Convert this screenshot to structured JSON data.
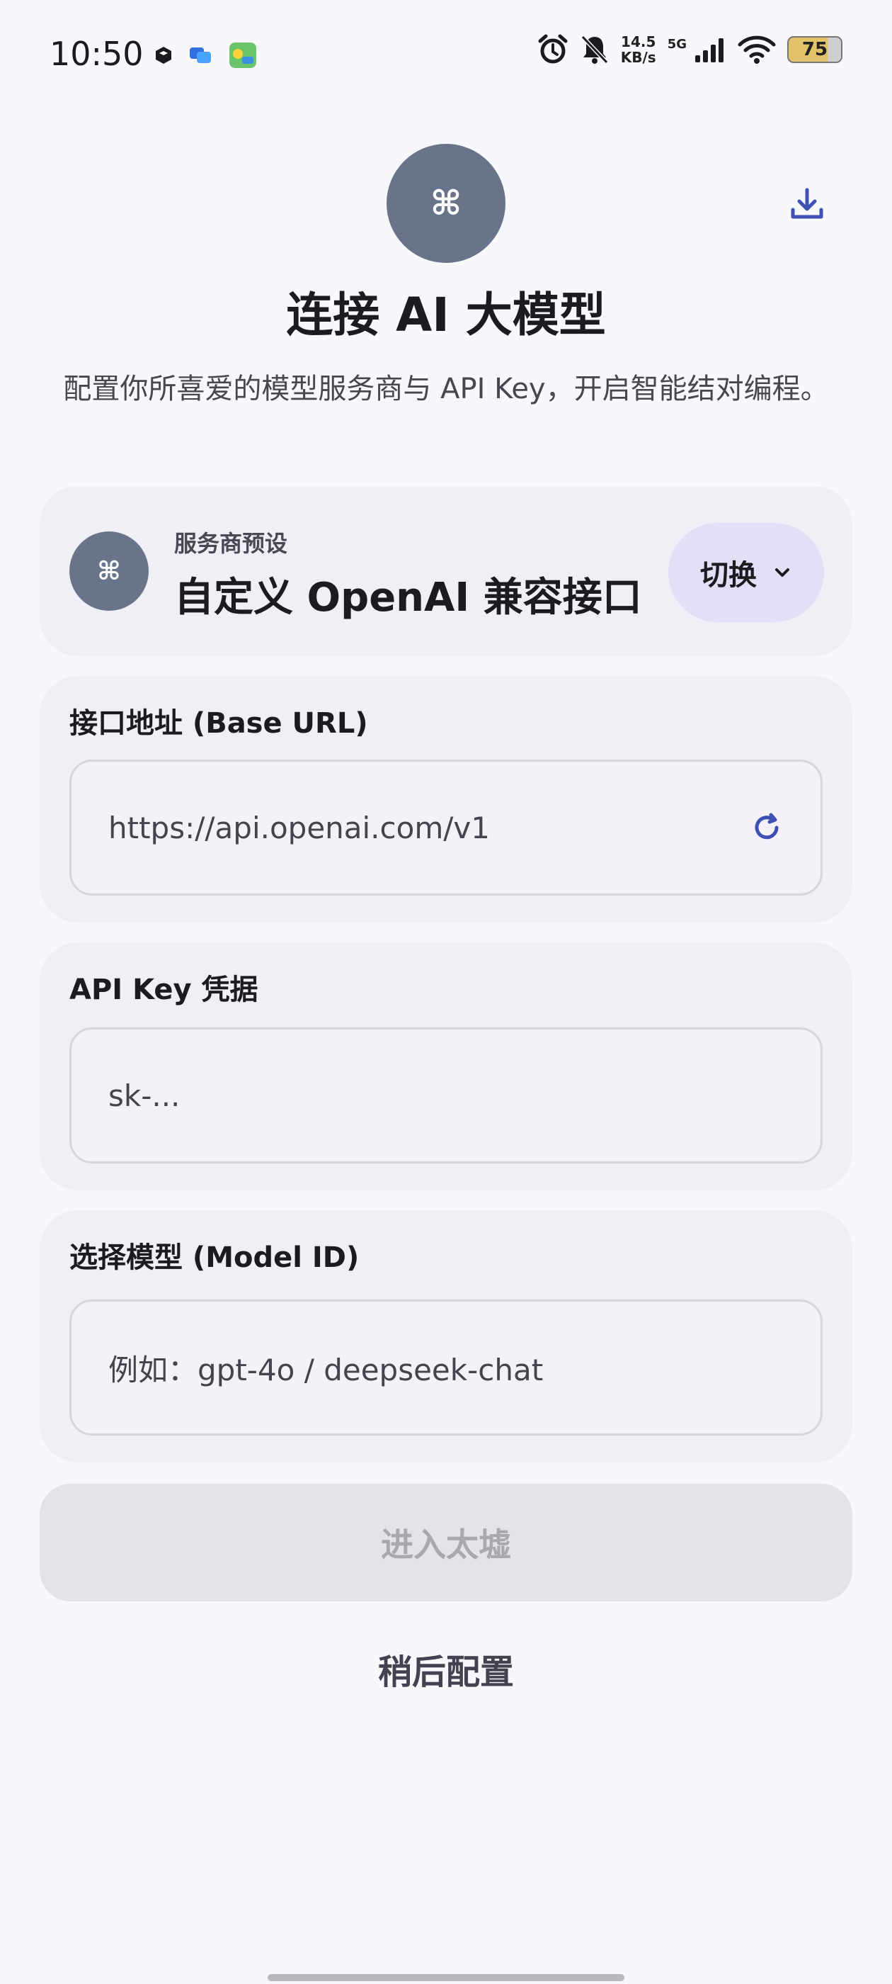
{
  "status_bar": {
    "time": "10:50",
    "net_speed_value": "14.5",
    "net_speed_unit": "KB/s",
    "network": "5G",
    "battery": "75"
  },
  "header": {
    "logo_glyph": "⌘",
    "title": "连接 AI 大模型",
    "subtitle": "配置你所喜爱的模型服务商与 API Key，开启智能结对编程。"
  },
  "provider": {
    "logo_glyph": "⌘",
    "label": "服务商预设",
    "name": "自定义 OpenAI 兼容接口",
    "switch_label": "切换"
  },
  "base_url": {
    "label": "接口地址 (Base URL)",
    "value": "https://api.openai.com/v1"
  },
  "api_key": {
    "label": "API Key 凭据",
    "placeholder": "sk-..."
  },
  "model": {
    "label": "选择模型 (Model ID)",
    "placeholder": "例如：gpt-4o / deepseek-chat"
  },
  "actions": {
    "enter_label": "进入太墟",
    "later_label": "稍后配置"
  },
  "colors": {
    "accent": "#3f51b5",
    "logo_bg": "#677489",
    "card_bg": "#f1eff6",
    "switch_bg": "#e1e0f7",
    "disabled_btn_bg": "#e4e3e8"
  }
}
